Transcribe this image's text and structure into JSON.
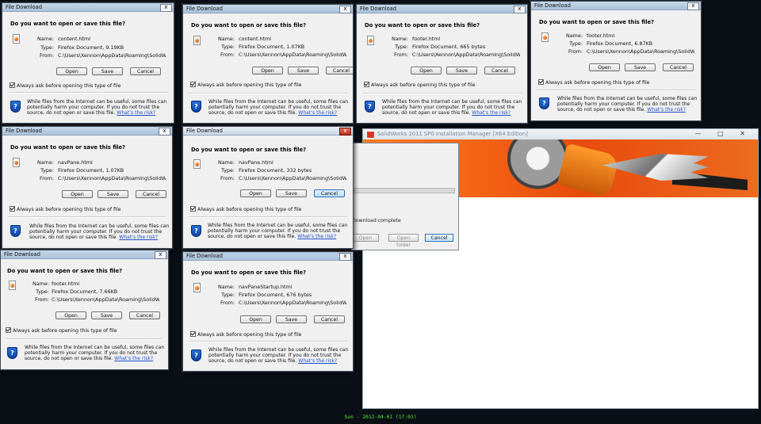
{
  "common": {
    "window_title": "File Download",
    "question": "Do you want to open or save this file?",
    "name_label": "Name:",
    "type_label": "Type:",
    "from_label": "From:",
    "open_label": "Open",
    "save_label": "Save",
    "cancel_label": "Cancel",
    "checkbox_label": "Always ask before opening this type of file",
    "warning_text": "While files from the Internet can be useful, some files can potentially harm your computer. If you do not trust the source, do not open or save this file.",
    "risk_link": "What's the risk?",
    "close_glyph": "x"
  },
  "dialogs": [
    {
      "name": "content.html",
      "type": "Firefox Document, 9.19KB",
      "from": "C:\\Users\\Xennon\\AppData\\Roaming\\SolidWor..."
    },
    {
      "name": "content.html",
      "type": "Firefox Document, 1.07KB",
      "from": "C:\\Users\\Xennon\\AppData\\Roaming\\SolidWor..."
    },
    {
      "name": "footer.html",
      "type": "Firefox Document, 665 bytes",
      "from": "C:\\Users\\Xennon\\AppData\\Roaming\\SolidWor..."
    },
    {
      "name": "footer.html",
      "type": "Firefox Document, 6.87KB",
      "from": "C:\\Users\\Xennon\\AppData\\Roaming\\SolidWor..."
    },
    {
      "name": "navPane.html",
      "type": "Firefox Document, 1.07KB",
      "from": "C:\\Users\\Xennon\\AppData\\Roaming\\SolidWor..."
    },
    {
      "name": "navPane.html",
      "type": "Firefox Document, 332 bytes",
      "from": "C:\\Users\\Xennon\\AppData\\Roaming\\SolidWor..."
    },
    {
      "name": "footer.html",
      "type": "Firefox Document, 7.66KB",
      "from": "C:\\Users\\Xennon\\AppData\\Roaming\\SolidWor..."
    },
    {
      "name": "navPaneStartup.html",
      "type": "Firefox Document, 676 bytes",
      "from": "C:\\Users\\Xennon\\AppData\\Roaming\\SolidWor..."
    }
  ],
  "solidworks": {
    "title": "SolidWorks 2011 SP0 Installation Manager [X64 Edition]",
    "download_status": "Download complete",
    "open_label": "Open",
    "open_folder_label": "Open folder",
    "cancel_label": "Cancel",
    "progress_percent": 100,
    "window_controls": "— □ ✕"
  },
  "taskbar": {
    "clock": "Sun - 2012-04-01 (17:02)"
  },
  "colors": {
    "desktop": "#0b1016",
    "accent_link": "#2050c8",
    "clock": "#4bea33"
  },
  "icons": {
    "file": "firefox-document-icon",
    "security": "shield-icon"
  }
}
